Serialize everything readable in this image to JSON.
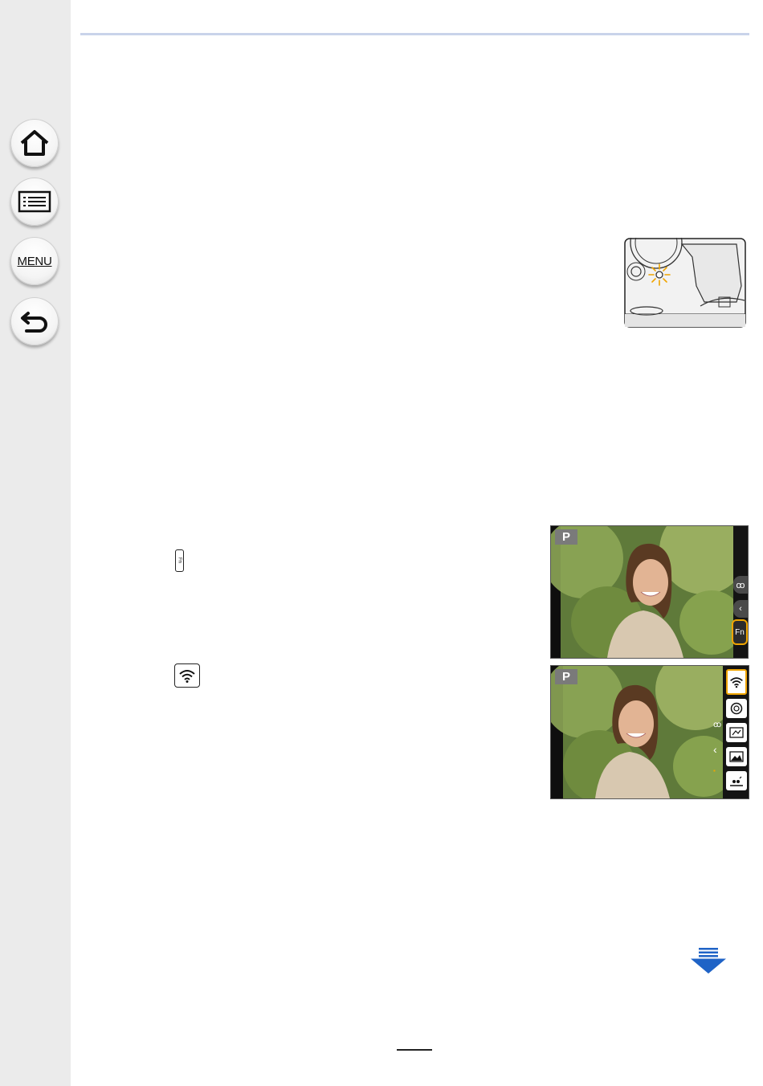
{
  "sidebar": {
    "home": {
      "icon": "home-icon"
    },
    "contents": {
      "icon": "list-icon"
    },
    "menu": {
      "label": "MENU"
    },
    "back": {
      "icon": "back-arrow-icon"
    }
  },
  "illustrations": {
    "camera_top": {
      "icon": "status-light-blink-icon"
    },
    "fn_inline": {
      "label": "Fn"
    },
    "screen1": {
      "mode_badge": "P",
      "fn_label": "Fn",
      "colors": {
        "highlight": "#f0a500"
      }
    },
    "screen2": {
      "mode_badge": "P",
      "colors": {
        "highlight": "#f0a500"
      }
    }
  },
  "next_page": {
    "icon": "next-page-arrow-icon",
    "color": "#1f63c6"
  },
  "page_number": ""
}
